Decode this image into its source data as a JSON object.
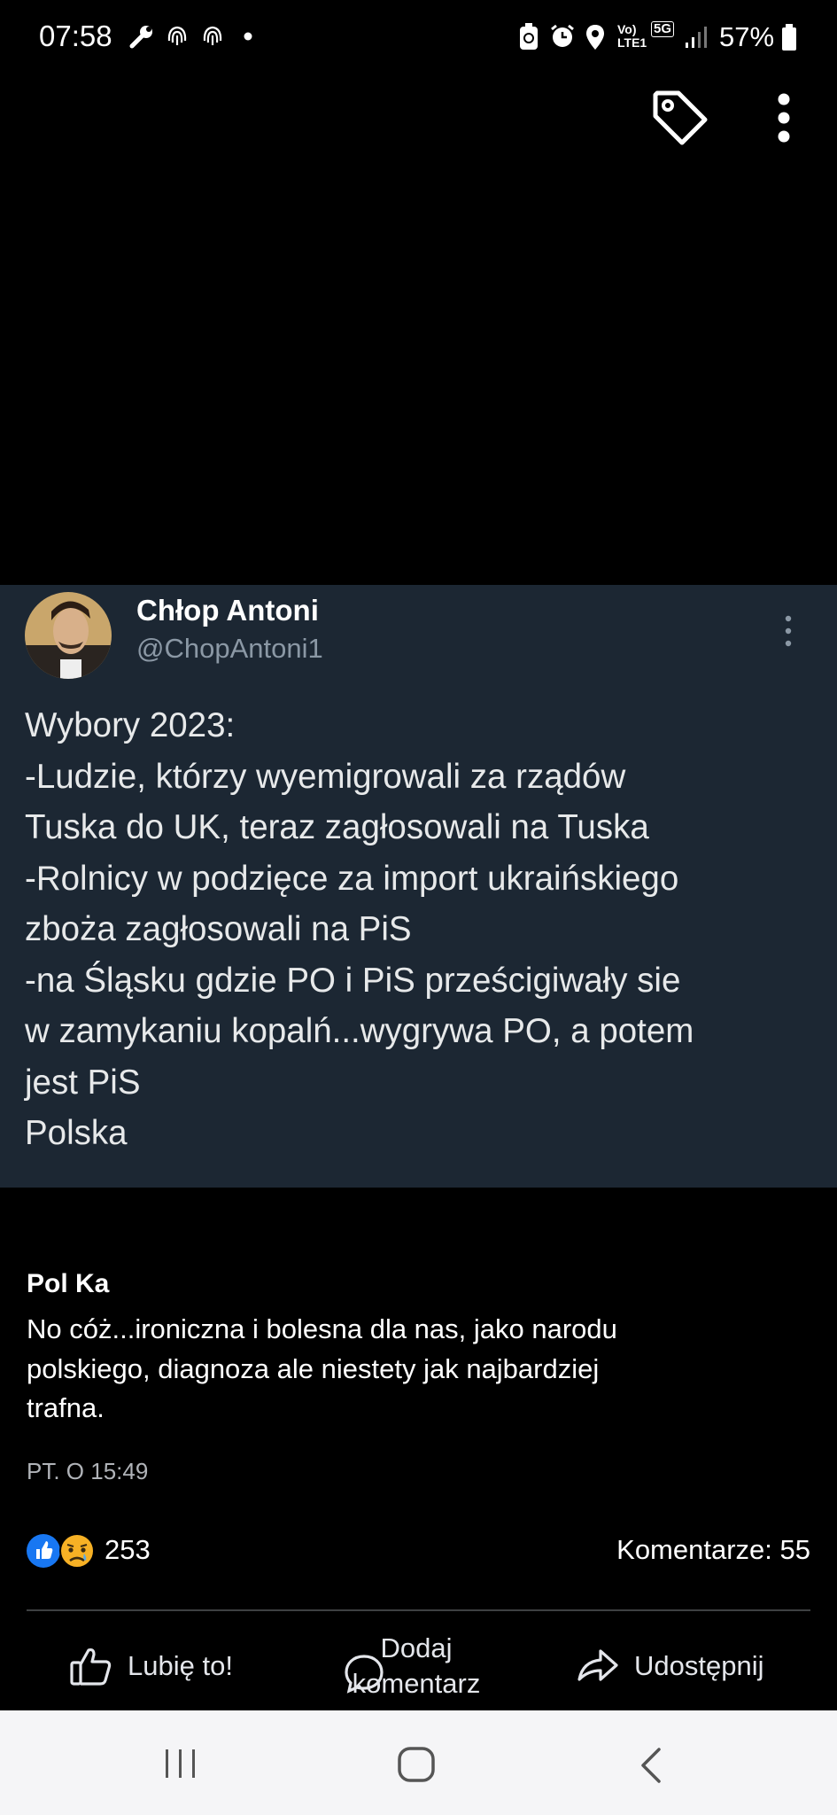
{
  "status_bar": {
    "time": "07:58",
    "network_vo": "Vo)",
    "network_lte": "LTE1",
    "network_5g": "5G",
    "battery": "57%",
    "icons": [
      "wrench-icon",
      "fingerprint-icon",
      "fingerprint-icon",
      "dot-icon",
      "battery-saver-icon",
      "alarm-icon",
      "location-icon",
      "signal-icon",
      "battery-icon"
    ]
  },
  "top_actions": {
    "icons": [
      "tag-icon",
      "more-vertical-icon"
    ]
  },
  "tweet": {
    "author": "Chłop Antoni",
    "handle": "@ChopAntoni1",
    "lines": [
      "Wybory 2023:",
      "-Ludzie, którzy wyemigrowali za rządów",
      "Tuska do UK, teraz zagłosowali na Tuska",
      "-Rolnicy w podzięce za import ukraińskiego",
      "zboża zagłosowali na PiS",
      "-na Śląsku gdzie PO i PiS prześcigiwały sie",
      "w zamykaniu kopalń...wygrywa PO, a potem",
      "jest PiS",
      "Polska"
    ]
  },
  "comment": {
    "author": "Pol Ka",
    "lines": [
      "No cóż...ironiczna i bolesna dla nas, jako narodu",
      "polskiego, diagnoza ale niestety jak najbardziej",
      "trafna."
    ],
    "time": "PT. O 15:49"
  },
  "reactions": {
    "count": "253",
    "comments": "Komentarze: 55",
    "colors": {
      "like": "#1877f2",
      "sad": "#f7b125"
    }
  },
  "actions": {
    "like": "Lubię to!",
    "comment_line1": "Dodaj",
    "comment_line2": "komentarz",
    "share": "Udostępnij"
  },
  "nav_bar": {
    "icons": [
      "recent-apps-icon",
      "home-icon",
      "back-icon"
    ]
  }
}
